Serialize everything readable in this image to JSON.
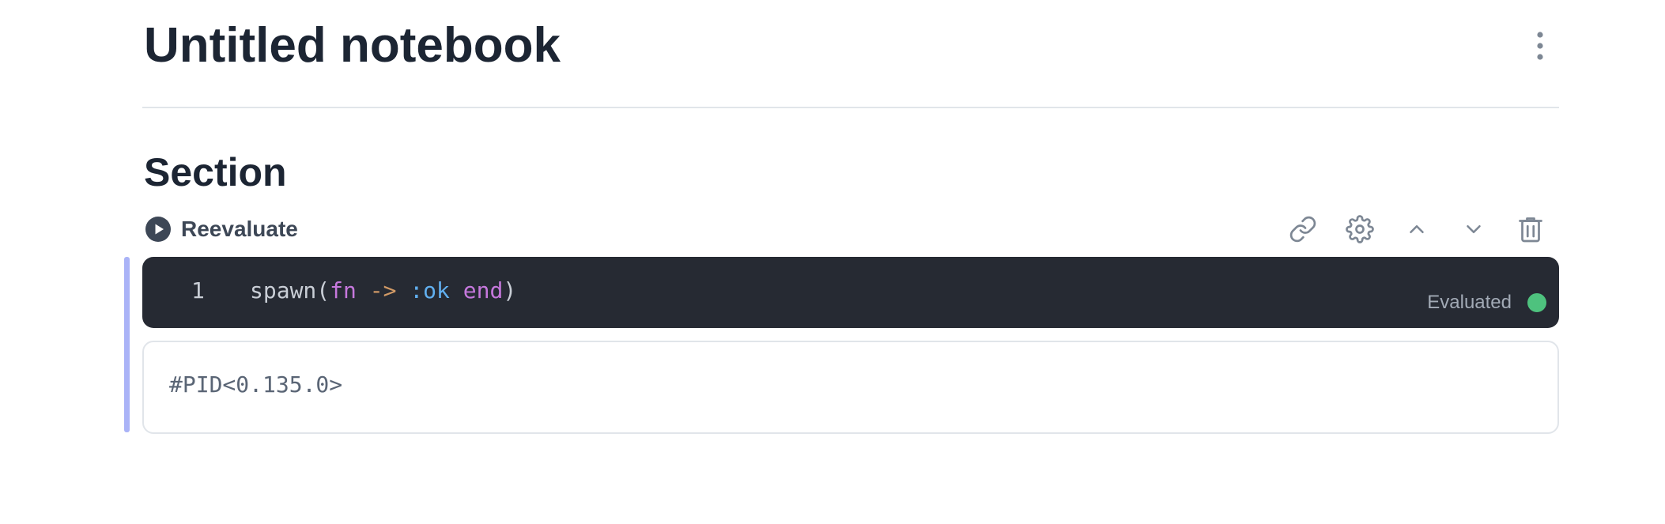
{
  "notebook": {
    "title": "Untitled notebook",
    "menu_icon": "vertical-dots-icon"
  },
  "section": {
    "title": "Section"
  },
  "cell": {
    "toolbar": {
      "reevaluate_label": "Reevaluate",
      "reevaluate_icon": "play-circle-icon",
      "actions": [
        "link-icon",
        "gear-icon",
        "chevron-up-icon",
        "chevron-down-icon",
        "trash-icon"
      ]
    },
    "editor": {
      "line_number": "1",
      "tokens": {
        "t1": "spawn(",
        "t2": "fn",
        "t3": " ",
        "t4": "->",
        "t5": " ",
        "t6": ":ok",
        "t7": " ",
        "t8": "end",
        "t9": ")"
      }
    },
    "status": {
      "label": "Evaluated",
      "color": "#4ec27e"
    },
    "output": {
      "text": "#PID<0.135.0>"
    }
  },
  "colors": {
    "editor_bg": "#262a33",
    "focus_bar": "#aab3f7",
    "keyword": "#c678dd",
    "operator": "#d19a66",
    "atom": "#61afef"
  }
}
